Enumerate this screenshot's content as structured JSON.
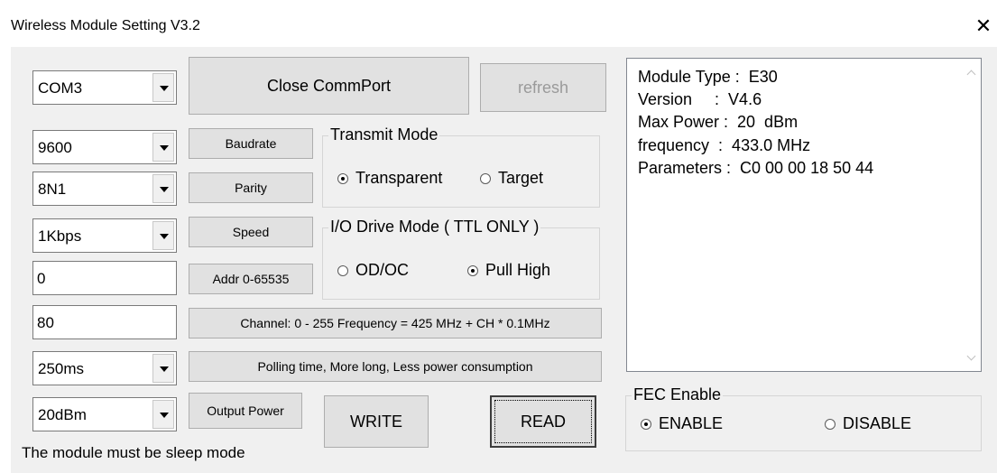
{
  "window": {
    "title": "Wireless Module Setting V3.2",
    "close_icon": "close-icon"
  },
  "port": {
    "com_selected": "COM3",
    "close_button": "Close CommPort",
    "refresh_button": "refresh"
  },
  "settings": {
    "baud_value": "9600",
    "baud_button": "Baudrate",
    "parity_value": "8N1",
    "parity_button": "Parity",
    "speed_value": "1Kbps",
    "speed_button": "Speed",
    "addr_value": "0",
    "addr_button": "Addr 0-65535",
    "channel_value": "80",
    "channel_button": "Channel: 0 - 255 Frequency = 425 MHz + CH * 0.1MHz",
    "polling_value": "250ms",
    "polling_button": "Polling time, More long, Less power consumption",
    "power_value": "20dBm",
    "power_button": "Output Power"
  },
  "transmit_mode": {
    "legend": "Transmit Mode",
    "option1": "Transparent",
    "option2": "Target",
    "selected": "Transparent"
  },
  "io_mode": {
    "legend": "I/O Drive Mode ( TTL ONLY )",
    "option1": "OD/OC",
    "option2": "Pull High",
    "selected": "Pull High"
  },
  "actions": {
    "write_button": "WRITE",
    "read_button": "READ"
  },
  "note": "The module must be sleep mode",
  "info": {
    "lines": [
      "Module Type :  E30",
      "Version     :  V4.6",
      "Max Power :  20  dBm",
      "frequency  :  433.0 MHz",
      "Parameters :  C0 00 00 18 50 44"
    ]
  },
  "fec": {
    "legend": "FEC Enable",
    "option1": "ENABLE",
    "option2": "DISABLE",
    "selected": "ENABLE"
  }
}
